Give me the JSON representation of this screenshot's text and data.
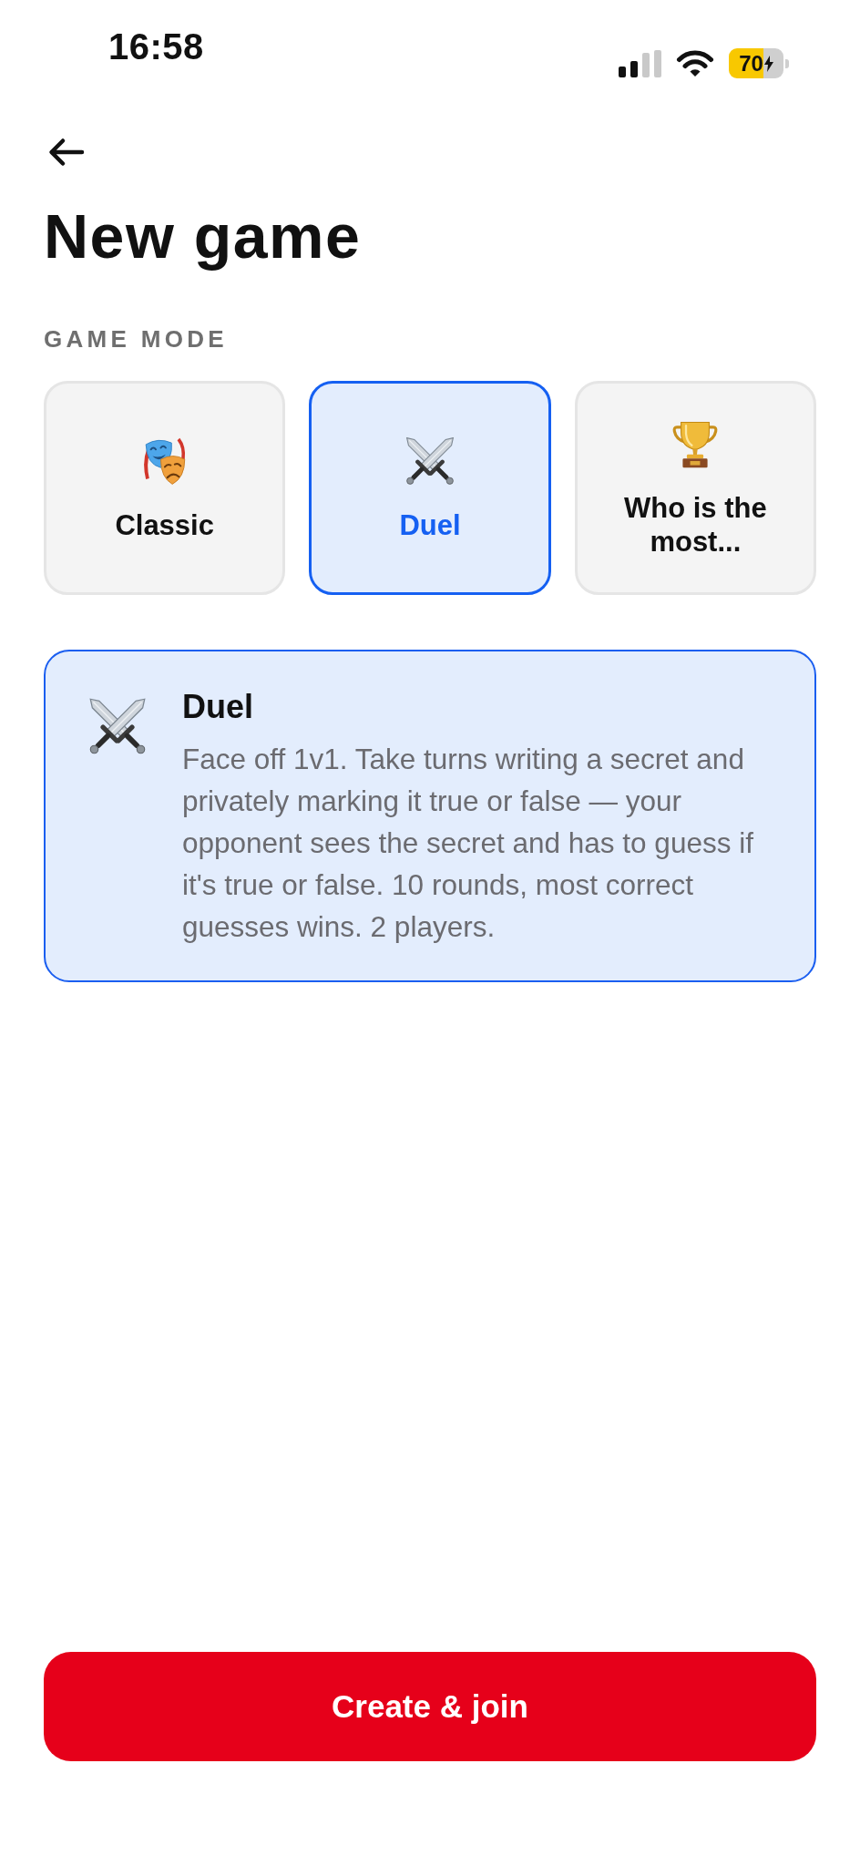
{
  "status_bar": {
    "time": "16:58",
    "battery": "70"
  },
  "header": {
    "title": "New game"
  },
  "section_label": "GAME MODE",
  "modes": [
    {
      "label": "Classic",
      "selected": false
    },
    {
      "label": "Duel",
      "selected": true
    },
    {
      "label": "Who is the most...",
      "selected": false
    }
  ],
  "description": {
    "title": "Duel",
    "text": "Face off 1v1. Take turns writing a secret and privately marking it true or false — your opponent sees the secret and has to guess if it's true or false. 10 rounds, most correct guesses wins. 2 players."
  },
  "primary_button": {
    "label": "Create & join"
  }
}
